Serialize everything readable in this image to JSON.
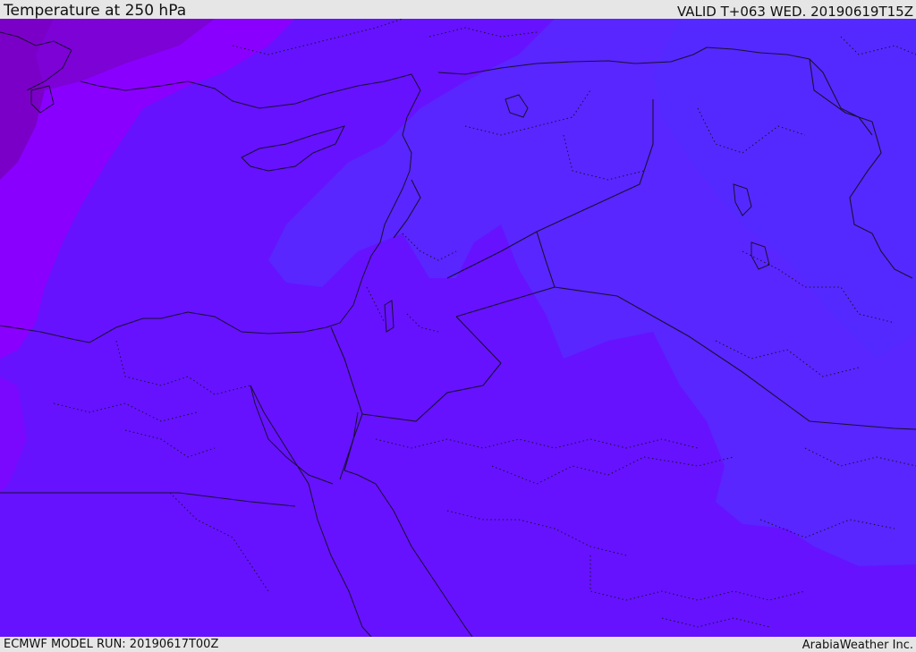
{
  "header": {
    "title": "Temperature at 250 hPa",
    "valid": "VALID T+063 WED. 20190619T15Z"
  },
  "footer": {
    "model_run": "ECMWF MODEL RUN: 20190617T00Z",
    "credit": "ArabiaWeather Inc."
  },
  "colors": {
    "deep_violet": "#7b00c7",
    "violet": "#8a00ff",
    "blue_violet": "#6a12ff",
    "indigo": "#5c22ff",
    "slate_blue": "#5429ff",
    "border": "#1a1030"
  }
}
